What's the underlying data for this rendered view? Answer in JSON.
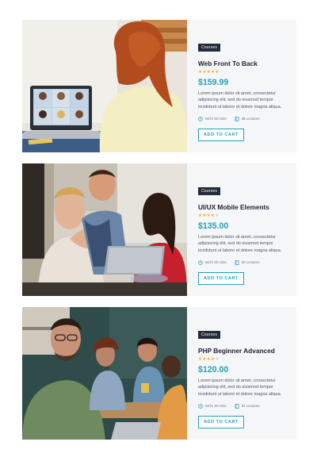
{
  "courses": [
    {
      "badge": "Courses",
      "title": "Web Front To Back",
      "rating": 5,
      "price": "$159.99",
      "description": "Lorem ipsum dolor sit amet, consectetur adipisicing elit, sed do eiusmod tempor incididunt ut labore et dolore magna aliqua.",
      "duration": "09 hr 30 mins",
      "lectures": "38 Lectures",
      "button": "ADD TO CART"
    },
    {
      "badge": "Courses",
      "title": "UI/UX Mobile Elements",
      "rating": 4,
      "price": "$135.00",
      "description": "Lorem ipsum dolor sit amet, consectetur adipisicing elit, sed do eiusmod tempor incididunt ut labore et dolore magna aliqua.",
      "duration": "06 hr 30 mins",
      "lectures": "20 Lectures",
      "button": "ADD TO CART"
    },
    {
      "badge": "Courses",
      "title": "PHP Beginner Advanced",
      "rating": 4,
      "price": "$120.00",
      "description": "Lorem ipsum dolor sit amet, consectetur adipisicing elit, sed do eiusmod tempor incididunt ut labore et dolore magna aliqua.",
      "duration": "08 hr 30 mins",
      "lectures": "32 Lectures",
      "button": "ADD TO CART"
    }
  ],
  "colors": {
    "accent": "#27a1b6",
    "star": "#f7b500",
    "badge_bg": "#262b3a",
    "card_bg": "#f5f6f8"
  },
  "icons": {
    "duration": "clock-icon",
    "lectures": "book-icon"
  }
}
